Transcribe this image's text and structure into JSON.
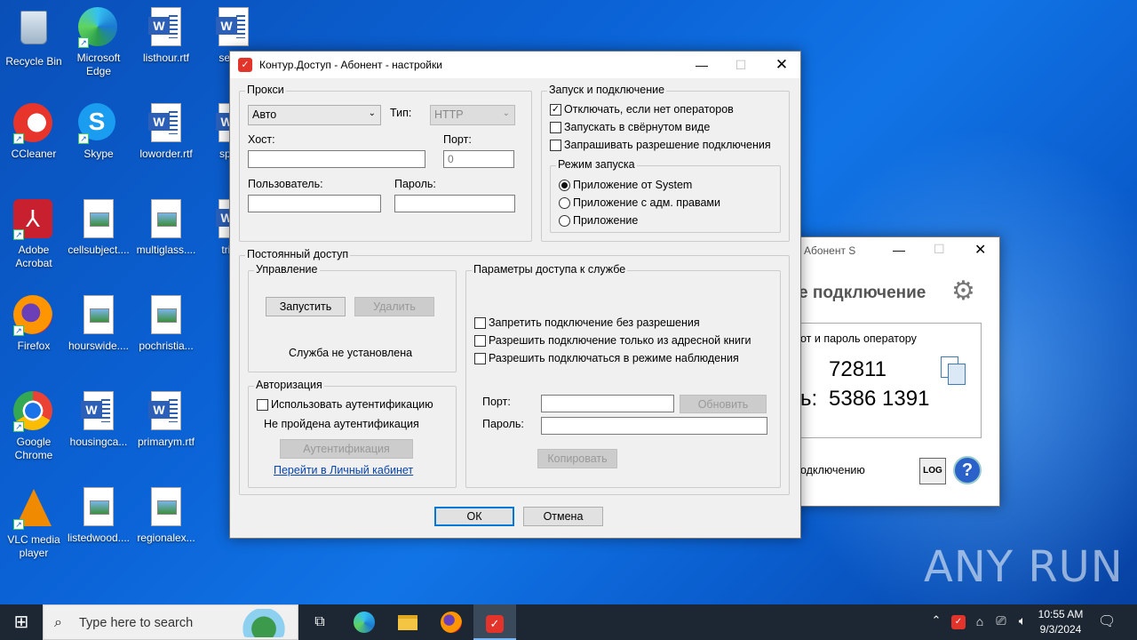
{
  "desktop": {
    "icons": [
      {
        "label": "Recycle Bin",
        "icon": "recycle-bin-icon"
      },
      {
        "label": "Microsoft Edge",
        "icon": "edge-icon"
      },
      {
        "label": "listhour.rtf",
        "icon": "word-doc-icon"
      },
      {
        "label": "server",
        "icon": "word-doc-icon"
      },
      {
        "label": "CCleaner",
        "icon": "ccleaner-icon"
      },
      {
        "label": "Skype",
        "icon": "skype-icon"
      },
      {
        "label": "loworder.rtf",
        "icon": "word-doc-icon"
      },
      {
        "label": "spons",
        "icon": "word-doc-icon"
      },
      {
        "label": "Adobe Acrobat",
        "icon": "acrobat-icon"
      },
      {
        "label": "cellsubject....",
        "icon": "image-doc-icon"
      },
      {
        "label": "multiglass....",
        "icon": "image-doc-icon"
      },
      {
        "label": "tripre",
        "icon": "word-doc-icon"
      },
      {
        "label": "Firefox",
        "icon": "firefox-icon"
      },
      {
        "label": "hourswide....",
        "icon": "image-doc-icon"
      },
      {
        "label": "pochristia...",
        "icon": "image-doc-icon"
      },
      {
        "label": "Google Chrome",
        "icon": "chrome-icon"
      },
      {
        "label": "housingca...",
        "icon": "word-doc-icon"
      },
      {
        "label": "primarym.rtf",
        "icon": "word-doc-icon"
      },
      {
        "label": "VLC media player",
        "icon": "vlc-icon"
      },
      {
        "label": "listedwood....",
        "icon": "image-doc-icon"
      },
      {
        "label": "regionalex...",
        "icon": "image-doc-icon"
      }
    ]
  },
  "back_window": {
    "title": "Абонент S",
    "heading": "е подключение",
    "operator_text": "от и пароль оператору",
    "id_value": "72811",
    "password_label": "ь:",
    "password_value": "5386 1391",
    "bottom_text": "одключению",
    "log_label": "LOG"
  },
  "dialog": {
    "title": "Контур.Доступ - Абонент - настройки",
    "proxy": {
      "legend": "Прокси",
      "mode_value": "Авто",
      "type_label": "Тип:",
      "type_value": "HTTP",
      "host_label": "Хост:",
      "host_value": "",
      "port_label": "Порт:",
      "port_value": "0",
      "user_label": "Пользователь:",
      "user_value": "",
      "password_label": "Пароль:",
      "password_value": ""
    },
    "startup": {
      "legend": "Запуск и подключение",
      "options": [
        {
          "label": "Отключать, если нет операторов",
          "checked": true
        },
        {
          "label": "Запускать в свёрнутом виде",
          "checked": false
        },
        {
          "label": "Запрашивать разрешение подключения",
          "checked": false
        }
      ],
      "mode_legend": "Режим запуска",
      "modes": [
        {
          "label": "Приложение от System",
          "selected": true
        },
        {
          "label": "Приложение с адм. правами",
          "selected": false
        },
        {
          "label": "Приложение",
          "selected": false
        }
      ]
    },
    "permanent": {
      "legend": "Постоянный доступ",
      "control_legend": "Управление",
      "start_button": "Запустить",
      "delete_button": "Удалить",
      "service_status": "Служба не установлена",
      "auth_legend": "Авторизация",
      "use_auth_label": "Использовать аутентификацию",
      "auth_status": "Не пройдена аутентификация",
      "auth_button": "Аутентификация",
      "cabinet_link": "Перейти в Личный кабинет",
      "params_legend": "Параметры доступа к службе",
      "params": [
        {
          "label": "Запретить подключение без разрешения",
          "checked": false
        },
        {
          "label": "Разрешить подключение только из адресной книги",
          "checked": false
        },
        {
          "label": "Разрешить подключаться в режиме наблюдения",
          "checked": false
        }
      ],
      "port_label": "Порт:",
      "port_value": "",
      "refresh_button": "Обновить",
      "password_label": "Пароль:",
      "password_value": "",
      "copy_button": "Копировать"
    },
    "ok_button": "ОК",
    "cancel_button": "Отмена"
  },
  "taskbar": {
    "search_placeholder": "Type here to search",
    "time": "10:55 AM",
    "date": "9/3/2024"
  },
  "watermark": "ANY RUN"
}
